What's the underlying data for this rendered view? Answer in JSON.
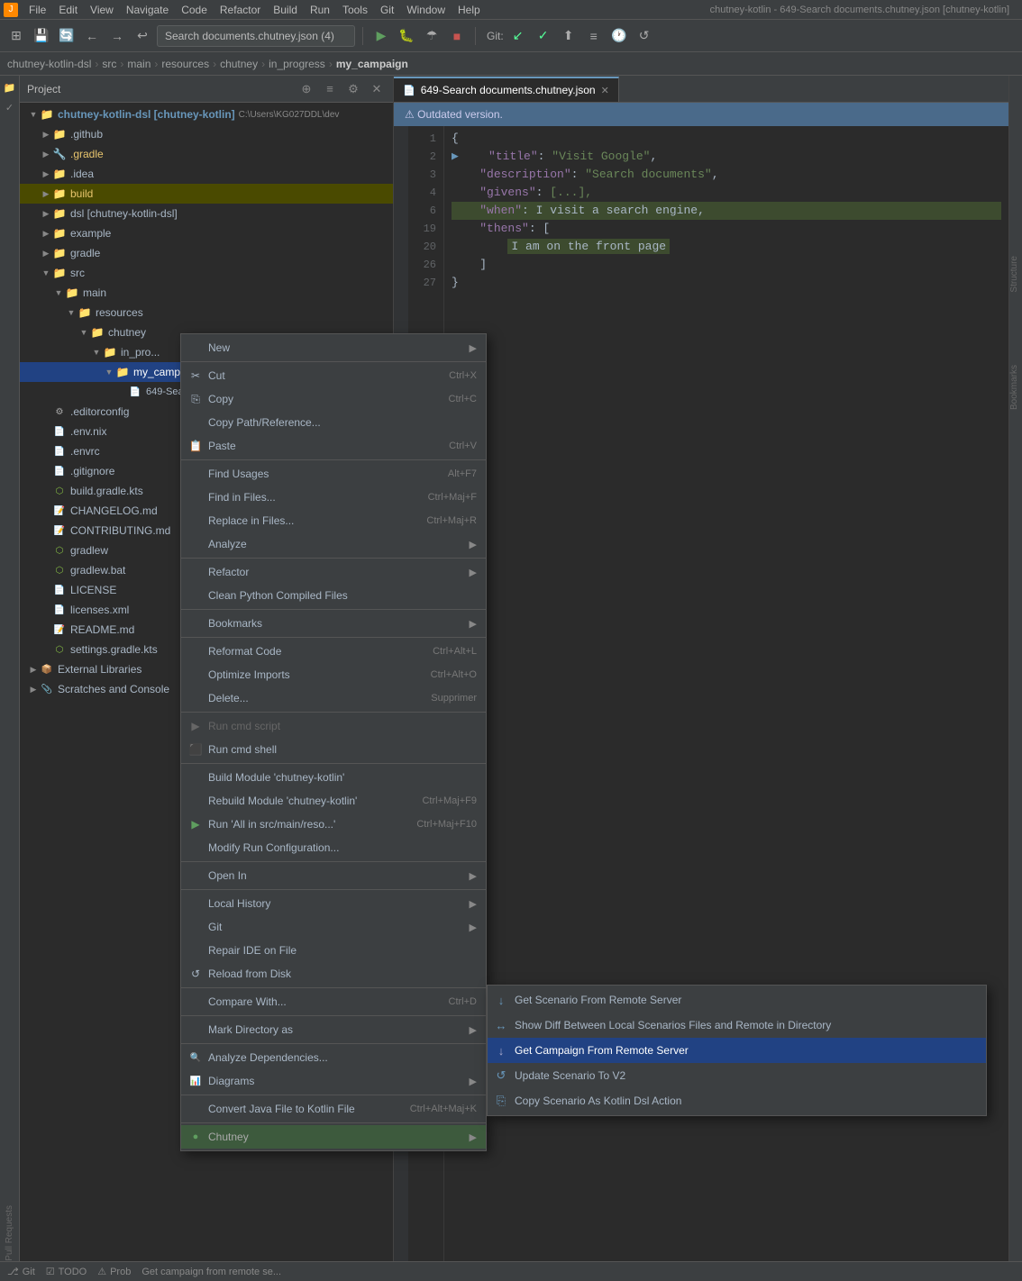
{
  "window": {
    "title": "chutney-kotlin - 649-Search documents.chutney.json [chutney-kotlin]"
  },
  "menubar": {
    "items": [
      "File",
      "Edit",
      "View",
      "Navigate",
      "Code",
      "Refactor",
      "Build",
      "Run",
      "Tools",
      "Git",
      "Window",
      "Help"
    ]
  },
  "toolbar": {
    "search_value": "Search documents.chutney.json (4)",
    "git_label": "Git:"
  },
  "breadcrumb": {
    "items": [
      "chutney-kotlin-dsl",
      "src",
      "main",
      "resources",
      "chutney",
      "in_progress",
      "my_campaign"
    ]
  },
  "project_panel": {
    "title": "Project",
    "root": "chutney-kotlin-dsl [chutney-kotlin]",
    "root_path": "C:\\Users\\KG027DDL\\dev",
    "items": [
      {
        "label": ".github",
        "type": "folder",
        "level": 1,
        "expanded": false
      },
      {
        "label": ".gradle",
        "type": "folder-gradle",
        "level": 1,
        "expanded": false
      },
      {
        "label": ".idea",
        "type": "folder",
        "level": 1,
        "expanded": false
      },
      {
        "label": "build",
        "type": "folder-build",
        "level": 1,
        "expanded": false
      },
      {
        "label": "dsl [chutney-kotlin-dsl]",
        "type": "folder",
        "level": 1,
        "expanded": false
      },
      {
        "label": "example",
        "type": "folder",
        "level": 1,
        "expanded": false
      },
      {
        "label": "gradle",
        "type": "folder",
        "level": 1,
        "expanded": false
      },
      {
        "label": "src",
        "type": "folder",
        "level": 1,
        "expanded": true
      },
      {
        "label": "main",
        "type": "folder",
        "level": 2,
        "expanded": true
      },
      {
        "label": "resources",
        "type": "folder",
        "level": 3,
        "expanded": true
      },
      {
        "label": "chutney",
        "type": "folder",
        "level": 4,
        "expanded": true
      },
      {
        "label": "in_pro...",
        "type": "folder",
        "level": 5,
        "expanded": true
      },
      {
        "label": "my_campaign",
        "type": "folder-selected",
        "level": 6,
        "expanded": true
      },
      {
        "label": "649-Search documents.chutney.json",
        "type": "file-json",
        "level": 7
      },
      {
        "label": ".editorconfig",
        "type": "file-config",
        "level": 1
      },
      {
        "label": ".env.nix",
        "type": "file-config",
        "level": 1
      },
      {
        "label": ".envrc",
        "type": "file-config",
        "level": 1
      },
      {
        "label": ".gitignore",
        "type": "file-config",
        "level": 1
      },
      {
        "label": "build.gradle.kts",
        "type": "file-kt",
        "level": 1
      },
      {
        "label": "CHANGELOG.md",
        "type": "file-md",
        "level": 1
      },
      {
        "label": "CONTRIBUTING.md",
        "type": "file-md",
        "level": 1
      },
      {
        "label": "gradlew",
        "type": "file",
        "level": 1
      },
      {
        "label": "gradlew.bat",
        "type": "file",
        "level": 1
      },
      {
        "label": "LICENSE",
        "type": "file",
        "level": 1
      },
      {
        "label": "licenses.xml",
        "type": "file",
        "level": 1
      },
      {
        "label": "README.md",
        "type": "file-md",
        "level": 1
      },
      {
        "label": "settings.gradle.kts",
        "type": "file-kt",
        "level": 1
      },
      {
        "label": "External Libraries",
        "type": "folder-special",
        "level": 0
      },
      {
        "label": "Scratches and Console",
        "type": "folder-special",
        "level": 0
      }
    ]
  },
  "editor": {
    "tab_label": "649-Search documents.chutney.json",
    "outdated_message": "Outdated version.",
    "lines": [
      {
        "num": "1",
        "content": "{",
        "type": "brace"
      },
      {
        "num": "2",
        "content": "    \"title\": \"Visit Google\",",
        "type": "kv",
        "has_arrow": true
      },
      {
        "num": "3",
        "content": "    \"description\": \"Search documents\",",
        "type": "kv"
      },
      {
        "num": "4",
        "content": "    \"givens\": [...],",
        "type": "kv"
      },
      {
        "num": "6",
        "content": "    \"when\": I visit a search engine,",
        "type": "kv-highlight"
      },
      {
        "num": "19",
        "content": "    \"thens\": [",
        "type": "kv"
      },
      {
        "num": "20",
        "content": "        I am on the front page",
        "type": "str-highlight"
      },
      {
        "num": "26",
        "content": "    ]",
        "type": "brace"
      },
      {
        "num": "27",
        "content": "}",
        "type": "brace"
      }
    ]
  },
  "context_menu": {
    "items": [
      {
        "label": "New",
        "shortcut": "",
        "has_arrow": true,
        "type": "normal"
      },
      {
        "label": "",
        "type": "separator"
      },
      {
        "label": "Cut",
        "shortcut": "Ctrl+X",
        "icon": "✂",
        "type": "normal"
      },
      {
        "label": "Copy",
        "shortcut": "Ctrl+C",
        "icon": "⎘",
        "type": "normal"
      },
      {
        "label": "Copy Path/Reference...",
        "shortcut": "",
        "type": "normal"
      },
      {
        "label": "Paste",
        "shortcut": "Ctrl+V",
        "icon": "📋",
        "type": "normal"
      },
      {
        "label": "",
        "type": "separator"
      },
      {
        "label": "Find Usages",
        "shortcut": "Alt+F7",
        "type": "normal"
      },
      {
        "label": "Find in Files...",
        "shortcut": "Ctrl+Maj+F",
        "type": "normal"
      },
      {
        "label": "Replace in Files...",
        "shortcut": "Ctrl+Maj+R",
        "type": "normal"
      },
      {
        "label": "Analyze",
        "shortcut": "",
        "has_arrow": true,
        "type": "normal"
      },
      {
        "label": "",
        "type": "separator"
      },
      {
        "label": "Refactor",
        "shortcut": "",
        "has_arrow": true,
        "type": "normal"
      },
      {
        "label": "Clean Python Compiled Files",
        "shortcut": "",
        "type": "normal"
      },
      {
        "label": "",
        "type": "separator"
      },
      {
        "label": "Bookmarks",
        "shortcut": "",
        "has_arrow": true,
        "type": "normal"
      },
      {
        "label": "",
        "type": "separator"
      },
      {
        "label": "Reformat Code",
        "shortcut": "Ctrl+Alt+L",
        "type": "normal"
      },
      {
        "label": "Optimize Imports",
        "shortcut": "Ctrl+Alt+O",
        "type": "normal"
      },
      {
        "label": "Delete...",
        "shortcut": "Supprimer",
        "type": "normal"
      },
      {
        "label": "",
        "type": "separator"
      },
      {
        "label": "Run cmd script",
        "shortcut": "",
        "type": "disabled",
        "icon": "▶"
      },
      {
        "label": "Run cmd shell",
        "shortcut": "",
        "type": "normal",
        "icon": "⬛"
      },
      {
        "label": "",
        "type": "separator"
      },
      {
        "label": "Build Module 'chutney-kotlin'",
        "shortcut": "",
        "type": "normal"
      },
      {
        "label": "Rebuild Module 'chutney-kotlin'",
        "shortcut": "Ctrl+Maj+F9",
        "type": "normal"
      },
      {
        "label": "Run 'All in src/main/reso...'",
        "shortcut": "Ctrl+Maj+F10",
        "type": "normal",
        "icon": "▶"
      },
      {
        "label": "Modify Run Configuration...",
        "shortcut": "",
        "type": "normal"
      },
      {
        "label": "",
        "type": "separator"
      },
      {
        "label": "Open In",
        "shortcut": "",
        "has_arrow": true,
        "type": "normal"
      },
      {
        "label": "",
        "type": "separator"
      },
      {
        "label": "Local History",
        "shortcut": "",
        "has_arrow": true,
        "type": "normal"
      },
      {
        "label": "Git",
        "shortcut": "",
        "has_arrow": true,
        "type": "normal"
      },
      {
        "label": "Repair IDE on File",
        "shortcut": "",
        "type": "normal"
      },
      {
        "label": "Reload from Disk",
        "shortcut": "",
        "icon": "↺",
        "type": "normal"
      },
      {
        "label": "",
        "type": "separator"
      },
      {
        "label": "Compare With...",
        "shortcut": "Ctrl+D",
        "type": "normal"
      },
      {
        "label": "",
        "type": "separator"
      },
      {
        "label": "Mark Directory as",
        "shortcut": "",
        "has_arrow": true,
        "type": "normal"
      },
      {
        "label": "",
        "type": "separator"
      },
      {
        "label": "Analyze Dependencies...",
        "shortcut": "",
        "icon": "🔍",
        "type": "normal"
      },
      {
        "label": "Diagrams",
        "shortcut": "",
        "has_arrow": true,
        "icon": "📊",
        "type": "normal"
      },
      {
        "label": "",
        "type": "separator"
      },
      {
        "label": "Convert Java File to Kotlin File",
        "shortcut": "Ctrl+Alt+Maj+K",
        "type": "normal"
      },
      {
        "label": "",
        "type": "separator"
      },
      {
        "label": "Chutney",
        "shortcut": "",
        "has_arrow": true,
        "type": "highlighted"
      }
    ]
  },
  "chutney_submenu": {
    "items": [
      {
        "label": "Get Scenario From Remote Server",
        "icon": "↓",
        "type": "normal"
      },
      {
        "label": "Show Diff Between Local Scenarios Files and Remote in Directory",
        "icon": "↔",
        "type": "normal"
      },
      {
        "label": "Get Campaign From Remote Server",
        "icon": "↓",
        "type": "active"
      },
      {
        "label": "Update Scenario To V2",
        "icon": "↺",
        "type": "normal"
      },
      {
        "label": "Copy Scenario As Kotlin Dsl Action",
        "icon": "⎘",
        "type": "normal"
      }
    ]
  },
  "status_bar": {
    "git_label": "Git",
    "todo_label": "TODO",
    "prob_label": "Prob",
    "message": "Get campaign from remote se..."
  }
}
